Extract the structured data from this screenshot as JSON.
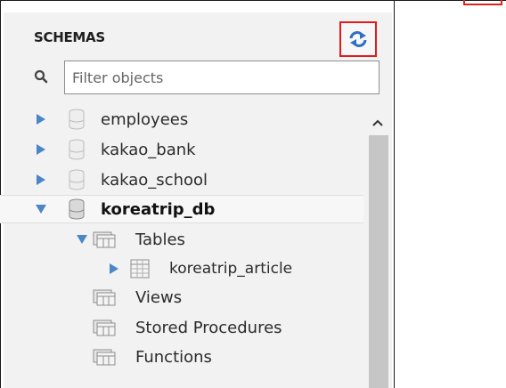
{
  "sidebar": {
    "title": "SCHEMAS",
    "filter_placeholder": "Filter objects"
  },
  "tree": {
    "schemas": [
      {
        "label": "employees",
        "expanded": false
      },
      {
        "label": "kakao_bank",
        "expanded": false
      },
      {
        "label": "kakao_school",
        "expanded": false
      },
      {
        "label": "koreatrip_db",
        "expanded": true
      }
    ],
    "koreatrip_children": {
      "tables": "Tables",
      "table_items": [
        "koreatrip_article"
      ],
      "views": "Views",
      "stored_procedures": "Stored Procedures",
      "functions": "Functions"
    }
  },
  "colors": {
    "highlight_border": "#e01c1c",
    "refresh_blue": "#2f6fc4",
    "panel_bg": "#f2f2f2"
  },
  "icons": {
    "refresh": "refresh-icon",
    "search": "search-icon",
    "schema": "database-icon",
    "folder": "folder-tables-icon",
    "table": "table-grid-icon"
  }
}
